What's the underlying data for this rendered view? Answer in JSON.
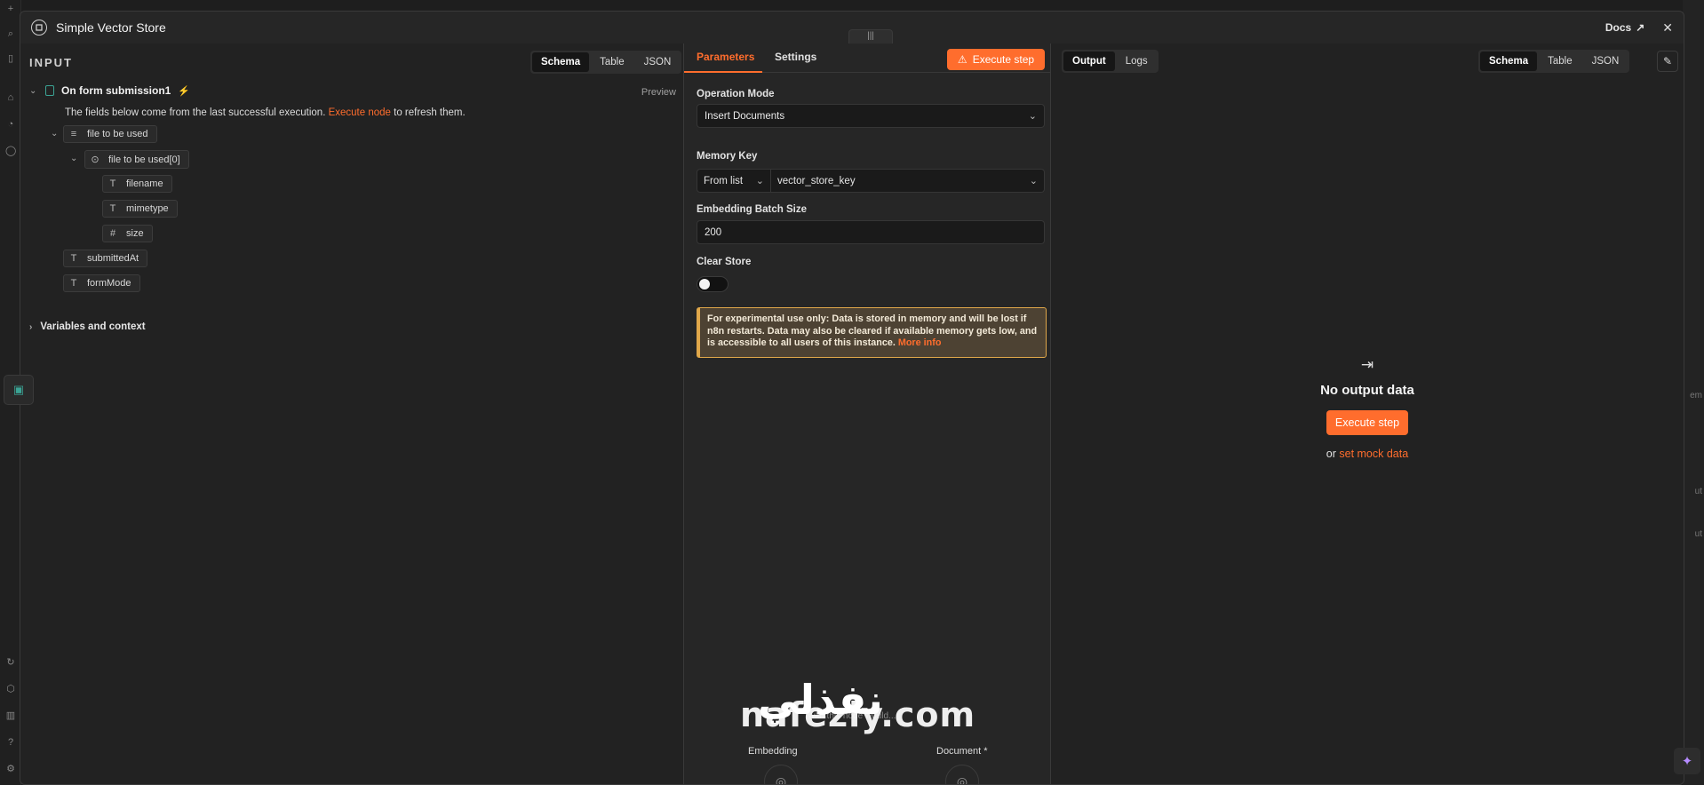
{
  "modal": {
    "title": "Simple Vector Store",
    "docs_label": "Docs",
    "close_icon": "close-icon"
  },
  "input_pane": {
    "label": "INPUT",
    "view_tabs": [
      "Schema",
      "Table",
      "JSON"
    ],
    "active_view": "Schema",
    "trigger_name": "On form submission1",
    "preview_label": "Preview",
    "info_prefix": "The fields below come from the last successful execution. ",
    "info_link": "Execute node",
    "info_suffix": " to refresh them.",
    "schema": [
      {
        "icon": "≡",
        "label": "file to be used"
      },
      {
        "icon": "⊙",
        "label": "file to be used[0]"
      },
      {
        "icon": "T",
        "label": "filename"
      },
      {
        "icon": "T",
        "label": "mimetype"
      },
      {
        "icon": "#",
        "label": "size"
      },
      {
        "icon": "T",
        "label": "submittedAt"
      },
      {
        "icon": "T",
        "label": "formMode"
      }
    ],
    "variables_label": "Variables and context"
  },
  "params_pane": {
    "tabs": [
      "Parameters",
      "Settings"
    ],
    "active_tab": "Parameters",
    "execute_label": "Execute step",
    "operation_mode_label": "Operation Mode",
    "operation_mode_value": "Insert Documents",
    "memory_key_label": "Memory Key",
    "memory_key_mode": "From list",
    "memory_key_value": "vector_store_key",
    "batch_size_label": "Embedding Batch Size",
    "batch_size_value": "200",
    "clear_store_label": "Clear Store",
    "clear_store_on": false,
    "notice_text": "For experimental use only: Data is stored in memory and will be lost if n8n restarts. Data may also be cleared if available memory gets low, and is accessible to all users of this instance. ",
    "notice_link": "More info",
    "bottom_hint": "with this node would...",
    "bottom_embedding": "Embedding",
    "bottom_document": "Document *"
  },
  "output_pane": {
    "tabs": [
      "Output",
      "Logs"
    ],
    "active_tab": "Output",
    "view_tabs": [
      "Schema",
      "Table",
      "JSON"
    ],
    "active_view": "Schema",
    "empty_title": "No output data",
    "empty_execute": "Execute step",
    "empty_or": "or ",
    "empty_mock_link": "set mock data"
  },
  "watermark": {
    "latin": "nafezly.com",
    "arabic": "نفذلي"
  },
  "bg_right_text": [
    "em",
    "ut",
    "ut"
  ],
  "colors": {
    "accent": "#ff6d2d",
    "trigger_teal": "#3ba394",
    "notice_border": "#e0a74a",
    "notice_bg": "#4d4233"
  }
}
